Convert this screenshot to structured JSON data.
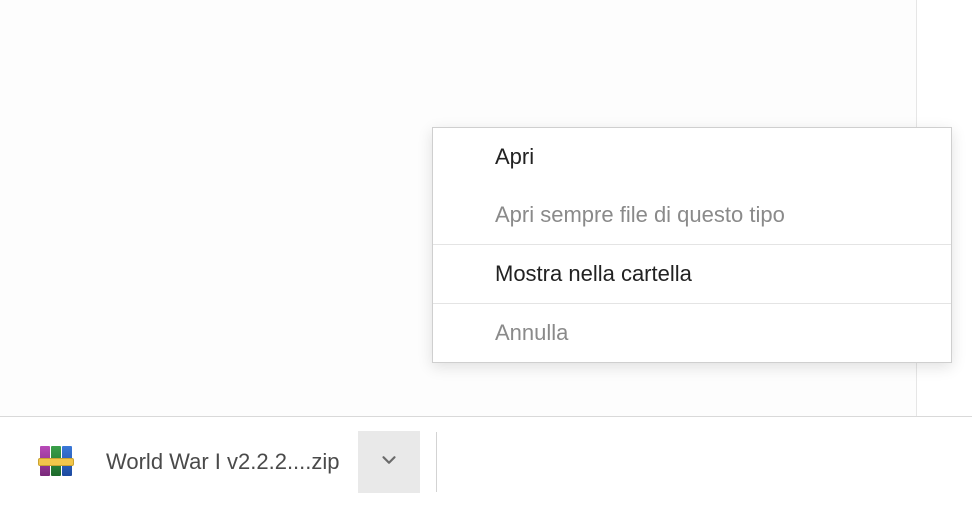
{
  "download": {
    "filename": "World War I v2.2.2....zip"
  },
  "menu": {
    "open": "Apri",
    "always_open": "Apri sempre file di questo tipo",
    "show_in_folder": "Mostra nella cartella",
    "cancel": "Annulla"
  }
}
